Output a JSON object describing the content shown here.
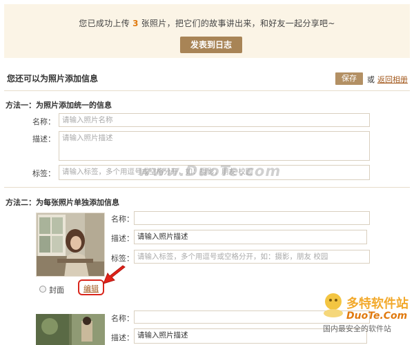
{
  "banner": {
    "message_prefix": "您已成功上传",
    "count": "3",
    "message_suffix": "张照片，把它们的故事讲出来，和好友一起分享吧~",
    "publish_label": "发表到日志"
  },
  "header": {
    "title": "您还可以为照片添加信息",
    "save_label": "保存",
    "or_text": "或",
    "return_label": "返回相册"
  },
  "method1": {
    "title": "方法一：为照片添加统一的信息",
    "name_label": "名称：",
    "name_placeholder": "请输入照片名称",
    "desc_label": "描述：",
    "desc_placeholder": "请输入照片描述",
    "tags_label": "标签：",
    "tags_placeholder": "请输入标签，多个用逗号或空格分开，如：摄影，朋友 校园"
  },
  "method2": {
    "title": "方法二：为每张照片单独添加信息",
    "photo1": {
      "name_label": "名称：",
      "name_value": "",
      "desc_label": "描述：",
      "desc_value": "请输入照片描述",
      "tags_label": "标签：",
      "tags_placeholder": "请输入标签，多个用逗号或空格分开，如：摄影，朋友 校园",
      "cover_label": "封面",
      "edit_label": "编辑"
    },
    "photo2": {
      "name_label": "名称：",
      "name_value": "",
      "desc_label": "描述：",
      "desc_value": "请输入照片描述"
    }
  },
  "watermark": {
    "center": "www.DuoTe.com",
    "logo_title": "多特软件站",
    "logo_url": "DuoTe.Com",
    "logo_slogan": "国内最安全的软件站"
  },
  "colors": {
    "accent": "#a88456",
    "banner_bg": "#fbf4e6",
    "link": "#a35a1f",
    "highlight_red": "#d9261c"
  }
}
